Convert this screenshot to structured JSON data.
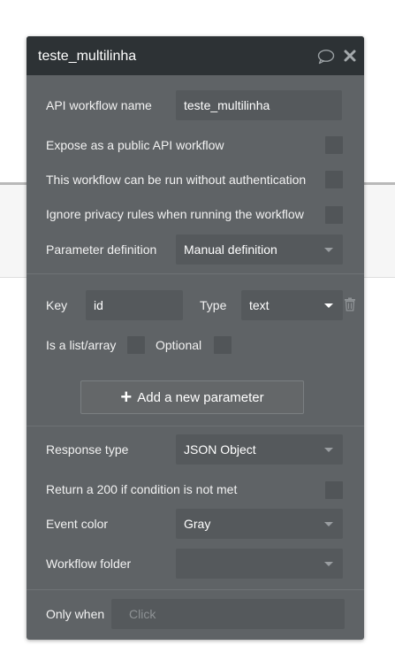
{
  "header": {
    "title": "teste_multilinha"
  },
  "form": {
    "api_name_label": "API workflow name",
    "api_name_value": "teste_multilinha",
    "expose_label": "Expose as a public API workflow",
    "no_auth_label": "This workflow can be run without authentication",
    "privacy_label": "Ignore privacy rules when running the workflow",
    "param_def_label": "Parameter definition",
    "param_def_value": "Manual definition",
    "key_label": "Key",
    "key_value": "id",
    "type_label": "Type",
    "type_value": "text",
    "is_list_label": "Is a list/array",
    "optional_label": "Optional",
    "add_param_label": "Add a new parameter",
    "response_type_label": "Response type",
    "response_type_value": "JSON Object",
    "return200_label": "Return a 200 if condition is not met",
    "event_color_label": "Event color",
    "event_color_value": "Gray",
    "folder_label": "Workflow folder",
    "folder_value": "",
    "only_when_label": "Only when",
    "only_when_placeholder": "Click"
  },
  "icons": {
    "comment": "comment-icon",
    "close": "close-icon",
    "trash": "trash-icon",
    "plus": "plus-icon"
  },
  "colors": {
    "panel": "#5f6366",
    "header": "#2d3235",
    "field": "#55595c"
  }
}
